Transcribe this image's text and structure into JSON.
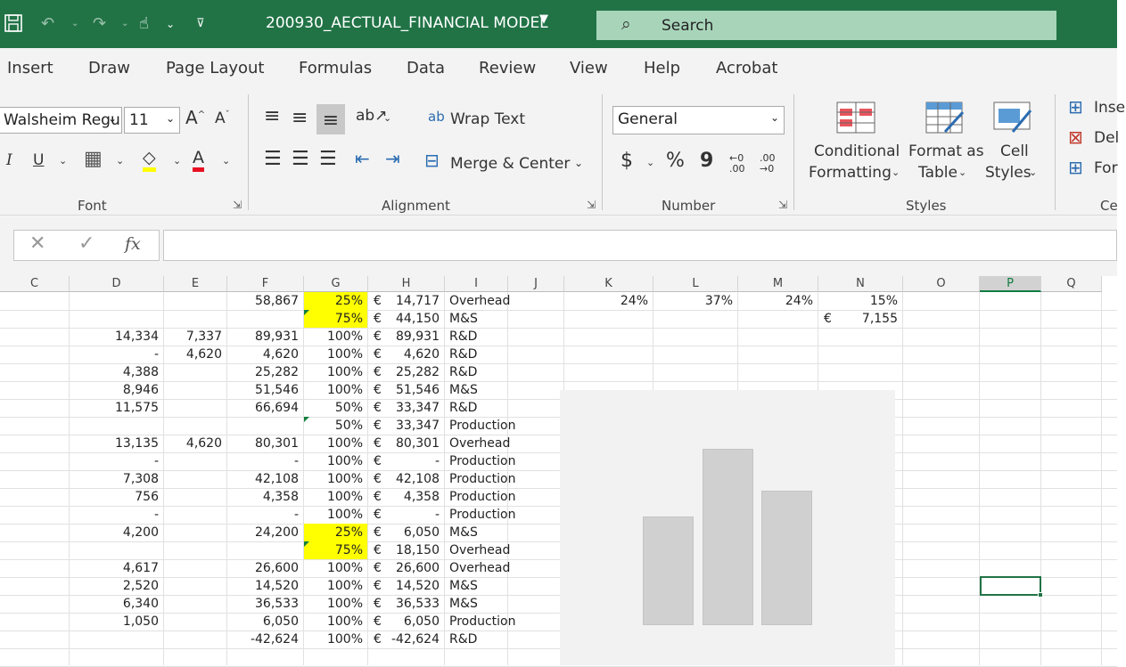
{
  "window": {
    "title": "200930_AECTUAL_FINANCIAL MODEL",
    "search_placeholder": "Search"
  },
  "tabs": [
    "Insert",
    "Draw",
    "Page Layout",
    "Formulas",
    "Data",
    "Review",
    "View",
    "Help",
    "Acrobat"
  ],
  "ribbon": {
    "font": {
      "font_name": "Walsheim Regul",
      "font_size": "11",
      "group_label": "Font"
    },
    "alignment": {
      "wrap_text": "Wrap Text",
      "merge_center": "Merge & Center",
      "group_label": "Alignment"
    },
    "number": {
      "format": "General",
      "currency": "$",
      "percent": "%",
      "comma": "9",
      "group_label": "Number"
    },
    "styles": {
      "conditional_1": "Conditional",
      "conditional_2": "Formatting",
      "format_table_1": "Format as",
      "format_table_2": "Table",
      "cell_styles_1": "Cell",
      "cell_styles_2": "Styles",
      "group_label": "Styles"
    },
    "cells": {
      "insert": "Inse",
      "delete": "Del",
      "format": "For",
      "group_label": "Ce"
    }
  },
  "formula_bar": {
    "cancel": "✕",
    "enter": "✓",
    "fx": "fx",
    "value": ""
  },
  "columns": [
    "C",
    "D",
    "E",
    "F",
    "G",
    "H",
    "I",
    "J",
    "K",
    "L",
    "M",
    "N",
    "O",
    "P",
    "Q"
  ],
  "selected_column": "P",
  "rows": [
    {
      "D": "",
      "E": "",
      "F": "58,867",
      "G": "25%",
      "G_hl": true,
      "H": "14,717",
      "I": "Overhead",
      "K": "24%",
      "L": "37%",
      "M": "24%",
      "N": "15%"
    },
    {
      "D": "",
      "E": "",
      "F": "",
      "G": "75%",
      "G_hl": true,
      "G_tri": true,
      "H": "44,150",
      "I": "M&S",
      "N_cur": "€",
      "N": "7,155"
    },
    {
      "D": "14,334",
      "E": "7,337",
      "F": "89,931",
      "G": "100%",
      "H": "89,931",
      "I": "R&D"
    },
    {
      "D": "-",
      "E": "4,620",
      "F": "4,620",
      "G": "100%",
      "H": "4,620",
      "I": "R&D"
    },
    {
      "D": "4,388",
      "E": "",
      "F": "25,282",
      "G": "100%",
      "H": "25,282",
      "I": "R&D"
    },
    {
      "D": "8,946",
      "E": "",
      "F": "51,546",
      "G": "100%",
      "H": "51,546",
      "I": "M&S"
    },
    {
      "D": "11,575",
      "E": "",
      "F": "66,694",
      "G": "50%",
      "H": "33,347",
      "I": "R&D"
    },
    {
      "D": "",
      "E": "",
      "F": "",
      "G": "50%",
      "G_tri": true,
      "H": "33,347",
      "I": "Production"
    },
    {
      "D": "13,135",
      "E": "4,620",
      "F": "80,301",
      "G": "100%",
      "H": "80,301",
      "I": "Overhead"
    },
    {
      "D": "-",
      "E": "",
      "F": "-",
      "G": "100%",
      "H": "-",
      "I": "Production"
    },
    {
      "D": "7,308",
      "E": "",
      "F": "42,108",
      "G": "100%",
      "H": "42,108",
      "I": "Production"
    },
    {
      "D": "756",
      "E": "",
      "F": "4,358",
      "G": "100%",
      "H": "4,358",
      "I": "Production"
    },
    {
      "D": "-",
      "E": "",
      "F": "-",
      "G": "100%",
      "H": "-",
      "I": "Production"
    },
    {
      "D": "4,200",
      "E": "",
      "F": "24,200",
      "G": "25%",
      "G_hl": true,
      "H": "6,050",
      "I": "M&S"
    },
    {
      "D": "",
      "E": "",
      "F": "",
      "G": "75%",
      "G_hl": true,
      "G_tri": true,
      "H": "18,150",
      "I": "Overhead"
    },
    {
      "D": "4,617",
      "E": "",
      "F": "26,600",
      "G": "100%",
      "H": "26,600",
      "I": "Overhead"
    },
    {
      "D": "2,520",
      "E": "",
      "F": "14,520",
      "G": "100%",
      "H": "14,520",
      "I": "M&S"
    },
    {
      "D": "6,340",
      "E": "",
      "F": "36,533",
      "G": "100%",
      "H": "36,533",
      "I": "M&S"
    },
    {
      "D": "1,050",
      "E": "",
      "F": "6,050",
      "G": "100%",
      "H": "6,050",
      "I": "Production"
    },
    {
      "D": "",
      "E": "",
      "F": "-42,624",
      "G": "100%",
      "H": "-42,624",
      "I": "R&D"
    }
  ],
  "currency_symbol": "€",
  "colors": {
    "accent": "#217346",
    "highlight": "#ffff00"
  }
}
